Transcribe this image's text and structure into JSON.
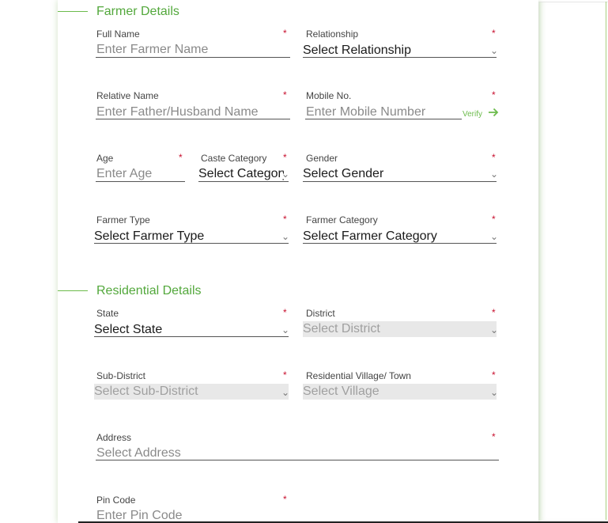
{
  "farmer_section": {
    "title": "Farmer Details"
  },
  "residential_section": {
    "title": "Residential Details"
  },
  "required_mark": "*",
  "fields": {
    "full_name": {
      "label": "Full Name",
      "placeholder": "Enter Farmer Name"
    },
    "relationship": {
      "label": "Relationship",
      "value": "Select Relationship"
    },
    "relative_name": {
      "label": "Relative Name",
      "placeholder": "Enter Father/Husband Name"
    },
    "mobile": {
      "label": "Mobile No.",
      "placeholder": "Enter Mobile Number",
      "verify_label": "Verify"
    },
    "age": {
      "label": "Age",
      "placeholder": "Enter Age"
    },
    "caste_category": {
      "label": "Caste Category",
      "value": "Select Category"
    },
    "gender": {
      "label": "Gender",
      "value": "Select Gender"
    },
    "farmer_type": {
      "label": "Farmer Type",
      "value": "Select Farmer Type"
    },
    "farmer_category": {
      "label": "Farmer Category",
      "value": "Select Farmer Category"
    },
    "state": {
      "label": "State",
      "value": "Select State"
    },
    "district": {
      "label": "District",
      "value": "Select District"
    },
    "sub_district": {
      "label": "Sub-District",
      "value": "Select Sub-District"
    },
    "village": {
      "label": "Residential Village/ Town",
      "value": "Select Village"
    },
    "address": {
      "label": "Address",
      "placeholder": "Select Address"
    },
    "pin_code": {
      "label": "Pin Code",
      "placeholder": "Enter Pin Code"
    }
  },
  "icons": {
    "dropdown": "chevron-down-icon",
    "verify": "arrow-right-icon"
  },
  "colors": {
    "accent": "#53a83c",
    "required": "#c8102e"
  }
}
